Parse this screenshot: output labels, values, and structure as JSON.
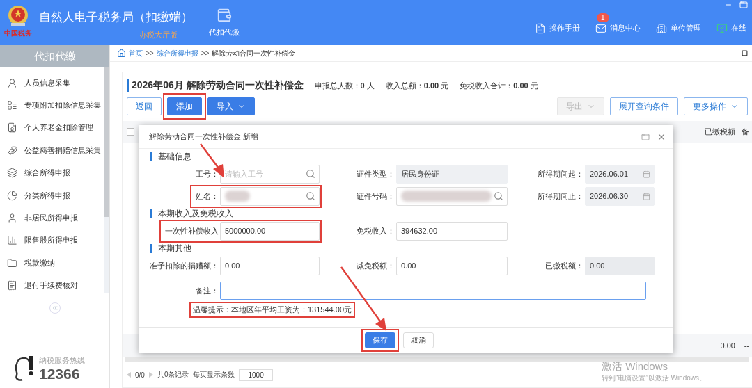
{
  "header": {
    "logo_text": "中国税务",
    "title": "自然人电子税务局（扣缴端）",
    "subtitle": "办税大厅版",
    "nav": [
      {
        "label": "代扣代缴",
        "selected": true
      }
    ],
    "links": [
      {
        "label": "操作手册"
      },
      {
        "label": "消息中心",
        "badge": "1"
      },
      {
        "label": "单位管理"
      },
      {
        "label": "在线"
      }
    ]
  },
  "sidebar": {
    "title": "代扣代缴",
    "items": [
      {
        "label": "人员信息采集"
      },
      {
        "label": "专项附加扣除信息采集"
      },
      {
        "label": "个人养老金扣除管理"
      },
      {
        "label": "公益慈善捐赠信息采集"
      },
      {
        "label": "综合所得申报"
      },
      {
        "label": "分类所得申报"
      },
      {
        "label": "非居民所得申报"
      },
      {
        "label": "限售股所得申报"
      },
      {
        "label": "税款缴纳"
      },
      {
        "label": "退付手续费核对"
      }
    ],
    "hotline_label": "纳税服务热线",
    "hotline_number": "12366"
  },
  "breadcrumb": {
    "separator": ">>",
    "items": [
      {
        "label": "首页",
        "link": true
      },
      {
        "label": "综合所得申报",
        "link": true
      },
      {
        "label": "解除劳动合同一次性补偿金",
        "link": false
      }
    ]
  },
  "page": {
    "title": "2026年06月 解除劳动合同一次性补偿金",
    "stats": [
      "申报总人数：**0** 人",
      "收入总额：**0.00** 元",
      "免税收入合计：**0.00** 元"
    ],
    "left_buttons": [
      {
        "label": "返回",
        "kind": "outline",
        "disabled": false,
        "highlighted": false
      },
      {
        "label": "添加",
        "kind": "primary",
        "disabled": false,
        "highlighted": true
      },
      {
        "label": "导入",
        "kind": "primary-dropdown",
        "disabled": false,
        "highlighted": false
      }
    ],
    "right_buttons": [
      {
        "label": "导出",
        "kind": "dropdown",
        "disabled": true,
        "highlighted": false
      },
      {
        "label": "展开查询条件",
        "kind": "outline",
        "disabled": false,
        "highlighted": false
      },
      {
        "label": "更多操作",
        "kind": "dropdown",
        "disabled": false,
        "highlighted": false
      }
    ]
  },
  "table": {
    "header_checkbox": {
      "checked": false
    },
    "columns": [
      "已缴税额",
      "备"
    ],
    "total_row": [
      "0.00",
      "--"
    ]
  },
  "pagination": {
    "page": "0/0",
    "total": "共0条记录",
    "page_size_label": "每页显示条数",
    "page_size": "1000"
  },
  "dialog": {
    "title": "解除劳动合同一次性补偿金 新增",
    "sections": [
      {
        "title": "基础信息",
        "rows": [
          [
            {
              "label": "工号：",
              "kind": "search",
              "placeholder": "请输入工号",
              "highlighted": false
            },
            {
              "label": "证件类型：",
              "kind": "readonly",
              "value": "居民身份证",
              "highlighted": false
            },
            {
              "label": "所得期间起：",
              "kind": "date",
              "value": "2026.06.01",
              "highlighted": false
            }
          ],
          [
            {
              "label": "姓名：",
              "kind": "redacted-search",
              "highlighted": true
            },
            {
              "label": "证件号码：",
              "kind": "redacted-search",
              "highlighted": false
            },
            {
              "label": "所得期间止：",
              "kind": "date",
              "value": "2026.06.30",
              "highlighted": false
            }
          ]
        ]
      },
      {
        "title": "本期收入及免税收入",
        "rows": [
          [
            {
              "label": "一次性补偿收入",
              "kind": "text",
              "value": "5000000.00",
              "highlighted": true
            },
            {
              "label": "免税收入：",
              "kind": "text",
              "value": "394632.00",
              "highlighted": false
            }
          ]
        ]
      },
      {
        "title": "本期其他",
        "rows": [
          [
            {
              "label": "准予扣除的捐赠额：",
              "kind": "text",
              "value": "0.00",
              "highlighted": false
            },
            {
              "label": "减免税额：",
              "kind": "text",
              "value": "0.00",
              "highlighted": false
            },
            {
              "label": "已缴税额：",
              "kind": "disabled",
              "value": "0.00",
              "highlighted": false
            }
          ]
        ]
      }
    ],
    "remark": {
      "label": "备注：",
      "focused": true
    },
    "hint": {
      "text": "温馨提示：本地区年平均工资为：131544.00元",
      "highlighted": true
    },
    "buttons": [
      {
        "label": "保存",
        "kind": "primary",
        "highlighted": true
      },
      {
        "label": "取消",
        "kind": "outline",
        "highlighted": false
      }
    ]
  },
  "watermark": {
    "title": "激活 Windows",
    "subtitle": "转到“电脑设置”以激活 Windows。"
  }
}
